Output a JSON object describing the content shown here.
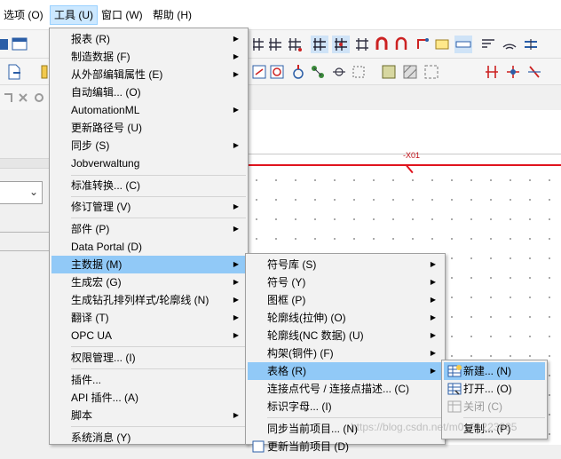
{
  "menubar": {
    "items": [
      {
        "label": "选项 (O)"
      },
      {
        "label": "工具 (U)"
      },
      {
        "label": "窗口 (W)"
      },
      {
        "label": "帮助 (H)"
      }
    ]
  },
  "tools_menu": {
    "items": [
      {
        "label": "报表 (R)",
        "submenu": true
      },
      {
        "label": "制造数据 (F)",
        "submenu": true
      },
      {
        "label": "从外部编辑属性 (E)",
        "submenu": true
      },
      {
        "label": "自动编辑... (O)",
        "submenu": false
      },
      {
        "label": "AutomationML",
        "submenu": true
      },
      {
        "label": "更新路径号 (U)",
        "submenu": false
      },
      {
        "label": "同步 (S)",
        "submenu": true
      },
      {
        "label": "Jobverwaltung",
        "submenu": false
      },
      {
        "label": "标准转换... (C)",
        "submenu": false
      },
      {
        "label": "修订管理 (V)",
        "submenu": true
      },
      {
        "label": "部件 (P)",
        "submenu": true
      },
      {
        "label": "Data Portal (D)",
        "submenu": false
      },
      {
        "label": "主数据 (M)",
        "submenu": true
      },
      {
        "label": "生成宏 (G)",
        "submenu": true
      },
      {
        "label": "生成钻孔排列样式/轮廓线 (N)",
        "submenu": true
      },
      {
        "label": "翻译 (T)",
        "submenu": true
      },
      {
        "label": "OPC UA",
        "submenu": true
      },
      {
        "label": "权限管理... (I)",
        "submenu": false
      },
      {
        "label": "插件...",
        "submenu": false
      },
      {
        "label": "API 插件... (A)",
        "submenu": false
      },
      {
        "label": "脚本",
        "submenu": true
      },
      {
        "label": "系统消息 (Y)",
        "submenu": false
      }
    ]
  },
  "master_data_menu": {
    "items": [
      {
        "label": "符号库 (S)",
        "submenu": true
      },
      {
        "label": "符号 (Y)",
        "submenu": true
      },
      {
        "label": "图框 (P)",
        "submenu": true
      },
      {
        "label": "轮廓线(拉伸) (O)",
        "submenu": true
      },
      {
        "label": "轮廓线(NC 数据) (U)",
        "submenu": true
      },
      {
        "label": "构架(铜件) (F)",
        "submenu": true
      },
      {
        "label": "表格 (R)",
        "submenu": true
      },
      {
        "label": "连接点代号 / 连接点描述... (C)",
        "submenu": false
      },
      {
        "label": "标识字母... (I)",
        "submenu": false
      },
      {
        "label": "同步当前项目... (N)",
        "submenu": false
      },
      {
        "label": "更新当前项目 (D)",
        "submenu": false
      }
    ]
  },
  "table_menu": {
    "items": [
      {
        "label": "新建... (N)",
        "icon": "new-table-icon"
      },
      {
        "label": "打开... (O)",
        "icon": "open-table-icon"
      },
      {
        "label": "关闭 (C)",
        "icon": "close-table-icon"
      },
      {
        "label": "复制... (P)",
        "icon": ""
      }
    ]
  },
  "canvas": {
    "tag": "-X01"
  },
  "watermark": "https://blog.csdn.net/m0_51223885",
  "colors": {
    "highlight": "#91c9f7",
    "menubar_active": "#cce8ff",
    "wire_red": "#e0141e"
  }
}
